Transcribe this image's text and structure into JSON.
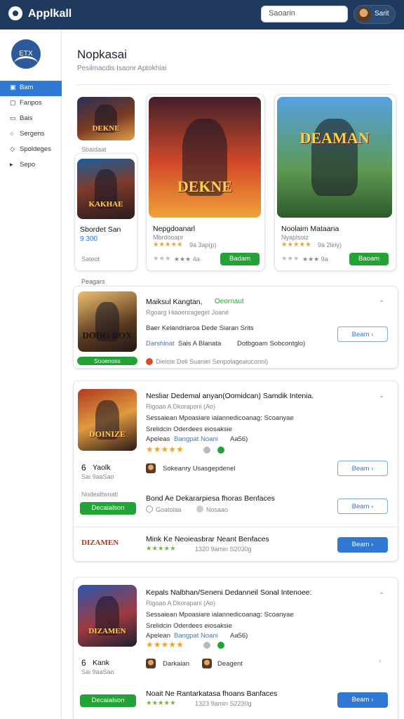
{
  "app": {
    "brand": "Applkall",
    "search_placeholder": "Saoarin",
    "user_label": "Sarit"
  },
  "sidebar": {
    "logo_text": "ETX",
    "items": [
      {
        "label": "Bam",
        "icon": "home-icon"
      },
      {
        "label": "Fanpos",
        "icon": "grid-icon"
      },
      {
        "label": "Bais",
        "icon": "list-icon"
      },
      {
        "label": "Sergens",
        "icon": "user-icon"
      },
      {
        "label": "Spoldeges",
        "icon": "bell-icon"
      },
      {
        "label": "Sepo",
        "icon": "settings-icon"
      }
    ]
  },
  "page": {
    "title": "Nopkasai",
    "subtitle": "Pesilmacdis Isaonr Aptokhiai"
  },
  "featured": {
    "small_label": "Sbaldaat",
    "small_name": "Sbordet San",
    "small_price": "9 300",
    "small_rating": "Sateot",
    "cards": [
      {
        "thumb_text": "DEKNE",
        "name": "Nepgdoanarl",
        "meta": "Mbrdooapr",
        "ratings": "9a 3ap(p)",
        "small_rating": "★★★ 4a",
        "button": "Badam"
      },
      {
        "thumb_text": "DEAMAN",
        "name": "Noolaim Mataana",
        "meta": "Nyaplsoiz",
        "ratings": "9a 2leiy)",
        "small_rating": "★★★ 9a",
        "button": "Baoam"
      }
    ]
  },
  "section_label": "Peagars",
  "list": [
    {
      "thumb_text": "DODO ROX",
      "title": "Maiksul Kangtan,",
      "title_tag": "Oeornaut",
      "line1": "Rgoarg Hiaoenrageget Joane",
      "line2": "Baer Kelandriaroa Dede Siaran Srits",
      "line3_a": "Darshinat",
      "line3_b": "Sais A Blanata",
      "line3_c": "Dotbgoam Sobcontglo)",
      "badge": "Sooenoss",
      "footer": "Dieiste Doli Suaniel Senpolageaiuconnl)",
      "button": "Beam"
    },
    {
      "thumb_text": "DOINIZE",
      "title": "Nesliar Dedemal anyan(Oomidcan) Samdik Intenia.",
      "line1": "Rigoao A Dkoraponi (Ao)",
      "line2": "Sessaiean Mpoasiare ialannedicoanag: Scoanyae",
      "line3": "Srelidcin Oderdees eiosaksie",
      "line4_a": "Apeleas",
      "line4_b": "Bangpat Noani",
      "line4_c": "Aa56)",
      "stat_icon": "6",
      "stat_name": "Yaolk",
      "stat_sub": "Sai 9aaSao",
      "author": "Sokeanry Usasgepdenel",
      "button": "Beam",
      "sub_label": "Nodealtwoatl",
      "sub_button": "Decaialson",
      "sub_text": "Bond Ae Dekararpiesa fhoras Benfaces",
      "sub_meta": "Goatoiaa",
      "sub_meta_b": "Nosaao",
      "sub_button2": "Beam",
      "sub2_logo": "DIZAMEN",
      "sub2_text": "Mink Ke Neoieasbrar Neant Benfaces",
      "sub2_meta": "1320 9amin S2030g",
      "sub2_button": "Beam"
    },
    {
      "thumb_text": "DIZAMEN",
      "title": "Kepals Nalbhan/Seneni Dedanneil Sonal Intenoee:",
      "line1": "Rigoao A Dkorapani (Ao)",
      "line2": "Sessaiean Mpoasiare ialannedicoanag: Scoanyae",
      "line3": "Srelidcin Oderdees eiosaksie",
      "line4_a": "Apelean",
      "line4_b": "Bangpat Noani",
      "line4_c": "Aa56)",
      "stat_icon": "6",
      "stat_name": "Kank",
      "stat_sub": "Sai 9aaSao",
      "author1": "Darkaian",
      "author2": "Deagent",
      "sub_button": "Decaialson",
      "sub_text": "Noait Ne Rantarkatasa fhoans Banfaces",
      "sub_meta": "1323 9amin S2230g",
      "sub_button2": "Beam"
    }
  ]
}
